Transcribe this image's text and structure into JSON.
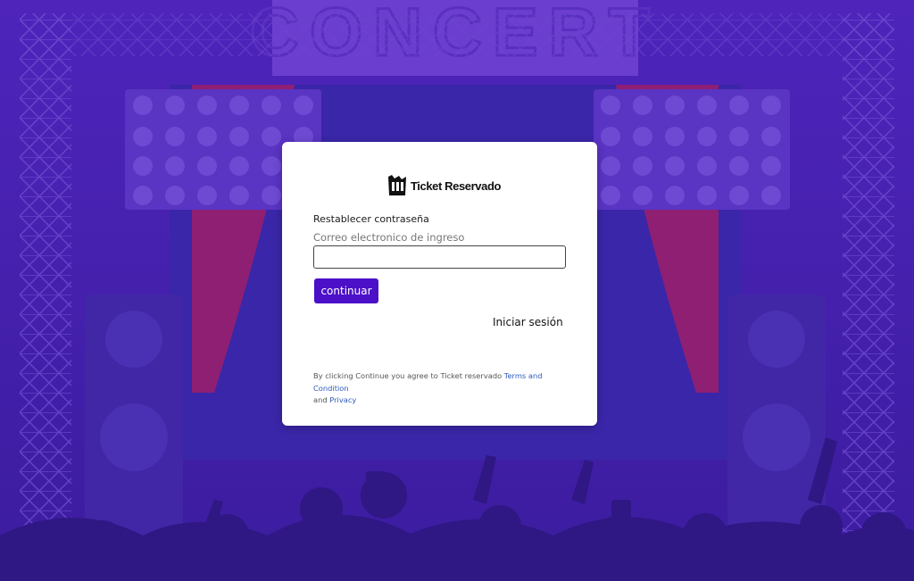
{
  "background": {
    "banner_text": "CONCERT",
    "colors": {
      "top": "#4d22b8",
      "bottom": "#3a1a9a",
      "curtain": "#9b1f6e"
    }
  },
  "card": {
    "logo_text": "Ticket Reservado",
    "title": "Restablecer contraseña",
    "email_label": "Correo electronico de ingreso",
    "email_value": "",
    "continue_label": "continuar",
    "login_link": "Iniciar sesión",
    "legal": {
      "prefix": "By clicking Continue you agree to Ticket reservado ",
      "terms_link": "Terms and Condition",
      "middle": "and ",
      "privacy_link": "Privacy"
    },
    "accent_color": "#4b10c8",
    "link_color": "#2c5bb8"
  }
}
